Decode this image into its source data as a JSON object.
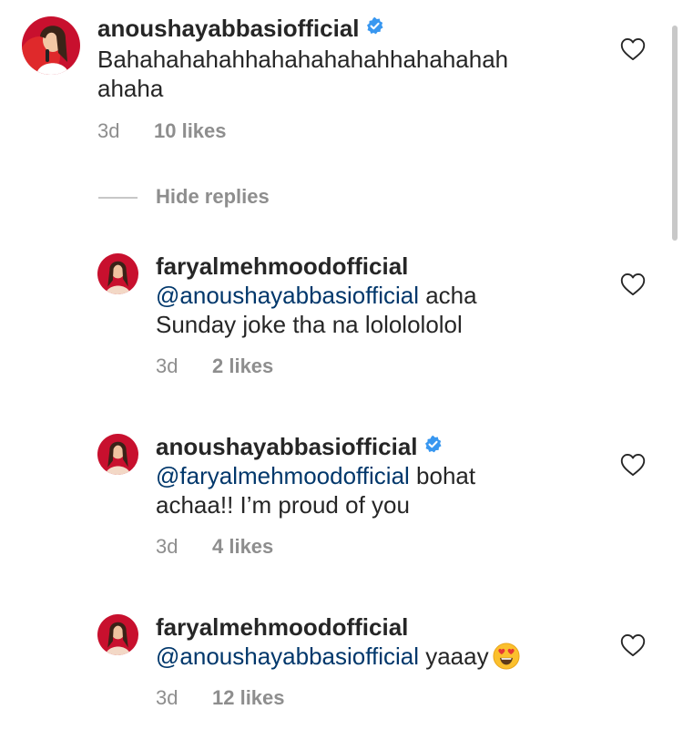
{
  "comments": [
    {
      "username": "anoushayabbasiofficial",
      "verified": true,
      "text_line1": "Bahahahahahhahahahahahhahahahah",
      "text_line2": "ahaha",
      "time": "3d",
      "likes": "10 likes"
    },
    {
      "username": "faryalmehmoodofficial",
      "verified": false,
      "mention": "@anoushayabbasiofficial",
      "text_line1_rest": " acha",
      "text_line2": "Sunday joke tha na lololololol",
      "time": "3d",
      "likes": "2 likes"
    },
    {
      "username": "anoushayabbasiofficial",
      "verified": true,
      "mention": "@faryalmehmoodofficial",
      "text_line1_rest": " bohat",
      "text_line2": "achaa!! I’m proud of you",
      "time": "3d",
      "likes": "4 likes"
    },
    {
      "username": "faryalmehmoodofficial",
      "verified": false,
      "mention": "@anoushayabbasiofficial",
      "text_line1_rest": " yaaay",
      "emoji": "heart-eyes-emoji",
      "time": "3d",
      "likes": "12 likes"
    }
  ],
  "replies_toggle": "Hide replies",
  "icons": {
    "like": "heart-outline-icon",
    "verified": "verified-badge-icon"
  },
  "colors": {
    "text": "#262626",
    "mention": "#00376b",
    "secondary": "#8e8e8e",
    "verified": "#3897f0"
  }
}
